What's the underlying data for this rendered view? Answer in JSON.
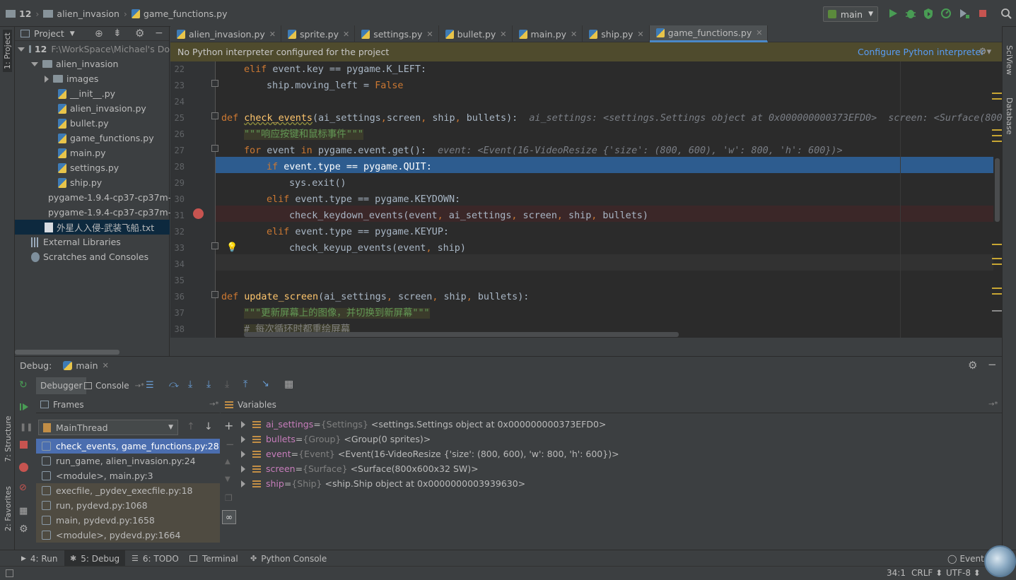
{
  "navbar": {
    "crumbs": [
      "12",
      "alien_invasion",
      "game_functions.py"
    ],
    "run_config": "main"
  },
  "left_stripe": {
    "project": "1: Project",
    "structure": "7: Structure",
    "favorites": "2: Favorites"
  },
  "right_stripe": {
    "sciview": "SciView",
    "database": "Database"
  },
  "project_panel": {
    "title": "Project",
    "tree": [
      {
        "label": "12",
        "extra": "F:\\WorkSpace\\Michael's Do",
        "kind": "folder",
        "depth": 0,
        "open": true
      },
      {
        "label": "alien_invasion",
        "kind": "folder",
        "depth": 1,
        "open": true
      },
      {
        "label": "images",
        "kind": "folder",
        "depth": 2,
        "open": false
      },
      {
        "label": "__init__.py",
        "kind": "py",
        "depth": 3
      },
      {
        "label": "alien_invasion.py",
        "kind": "py",
        "depth": 3
      },
      {
        "label": "bullet.py",
        "kind": "py",
        "depth": 3
      },
      {
        "label": "game_functions.py",
        "kind": "py",
        "depth": 3
      },
      {
        "label": "main.py",
        "kind": "py",
        "depth": 3
      },
      {
        "label": "settings.py",
        "kind": "py",
        "depth": 3
      },
      {
        "label": "ship.py",
        "kind": "py",
        "depth": 3
      },
      {
        "label": "pygame-1.9.4-cp37-cp37m-",
        "kind": "file",
        "depth": 2
      },
      {
        "label": "pygame-1.9.4-cp37-cp37m-",
        "kind": "file",
        "depth": 2
      },
      {
        "label": "外星人入侵-武装飞船.txt",
        "kind": "txt",
        "depth": 2,
        "selected": true
      },
      {
        "label": "External Libraries",
        "kind": "lib",
        "depth": 1
      },
      {
        "label": "Scratches and Consoles",
        "kind": "scratch",
        "depth": 1
      }
    ]
  },
  "tabs": [
    {
      "label": "alien_invasion.py"
    },
    {
      "label": "sprite.py"
    },
    {
      "label": "settings.py"
    },
    {
      "label": "bullet.py"
    },
    {
      "label": "main.py"
    },
    {
      "label": "ship.py"
    },
    {
      "label": "game_functions.py",
      "active": true
    }
  ],
  "banner": {
    "message": "No Python interpreter configured for the project",
    "action": "Configure Python interpreter"
  },
  "editor": {
    "line_numbers": [
      "22",
      "23",
      "24",
      "25",
      "26",
      "27",
      "28",
      "29",
      "30",
      "31",
      "32",
      "33",
      "34",
      "35",
      "36",
      "37",
      "38"
    ],
    "current_position": "34:1"
  },
  "debug": {
    "title": "Debug:",
    "session": "main",
    "subtabs": {
      "debugger": "Debugger",
      "console": "Console"
    },
    "frames_title": "Frames",
    "variables_title": "Variables",
    "thread": "MainThread",
    "frames": [
      {
        "label": "check_events, game_functions.py:28",
        "state": "selected"
      },
      {
        "label": "run_game, alien_invasion.py:24",
        "state": "user"
      },
      {
        "label": "<module>, main.py:3",
        "state": "user"
      },
      {
        "label": "execfile, _pydev_execfile.py:18",
        "state": "lib"
      },
      {
        "label": "run, pydevd.py:1068",
        "state": "lib"
      },
      {
        "label": "main, pydevd.py:1658",
        "state": "lib"
      },
      {
        "label": "<module>, pydevd.py:1664",
        "state": "lib"
      }
    ],
    "variables": [
      {
        "name": "ai_settings",
        "type": "{Settings}",
        "value": "<settings.Settings object at 0x000000000373EFD0>"
      },
      {
        "name": "bullets",
        "type": "{Group}",
        "value": "<Group(0 sprites)>"
      },
      {
        "name": "event",
        "type": "{Event}",
        "value": "<Event(16-VideoResize {'size': (800, 600), 'w': 800, 'h': 600})>"
      },
      {
        "name": "screen",
        "type": "{Surface}",
        "value": "<Surface(800x600x32 SW)>"
      },
      {
        "name": "ship",
        "type": "{Ship}",
        "value": "<ship.Ship object at 0x0000000003939630>"
      }
    ]
  },
  "bottom_tabs": [
    {
      "label": "4: Run"
    },
    {
      "label": "5: Debug",
      "active": true
    },
    {
      "label": "6: TODO"
    },
    {
      "label": "Terminal"
    },
    {
      "label": "Python Console"
    }
  ],
  "event_log": "Event",
  "status": {
    "position": "34:1",
    "line_sep": "CRLF",
    "encoding": "UTF-8"
  },
  "colors": {
    "accent": "#4a88c7",
    "selection": "#2d5c8f",
    "breakpoint": "#c75450",
    "banner": "#4f4b2d"
  }
}
